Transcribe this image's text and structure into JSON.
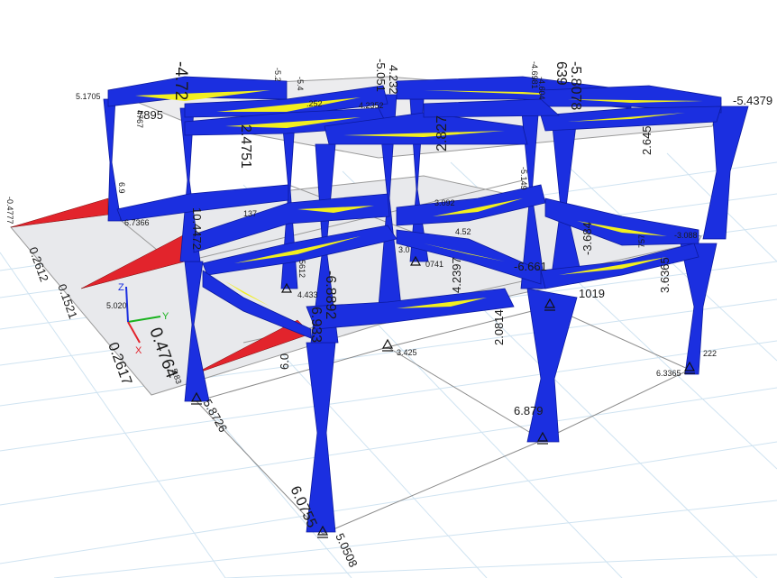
{
  "colors": {
    "background": "#ffffff",
    "grid": "#cfe3f1",
    "slab": "#e8e9ec",
    "frame_blue": "#1b2fe0",
    "frame_blue_dark": "#0c1a9e",
    "positive_yellow": "#f2ef1f",
    "negative_red": "#e2242c",
    "support": "#111111",
    "axis_x": "#e2242c",
    "axis_y": "#19b21e",
    "axis_z": "#1b2fe0"
  },
  "axes": {
    "x": "X",
    "y": "Y",
    "z": "Z"
  },
  "labels": {
    "c_top_left_big": "-4.72",
    "c_top_2": "-5.2",
    "c_top_3": "-5.4",
    "c_top_4": "-5.051",
    "c_top_5": "4.232",
    "c_top_6": "4.2352",
    "c_top_7": "-4.6981",
    "c_top_8": "-4.604",
    "c_top_9": "639",
    "c_top_10": "-5.8078",
    "c_right_top": "-5.4379",
    "c_roof_a": "5.1705",
    "c_roof_b": "7895",
    "c_roof_c": "4767",
    "c_roof_d": "2.4751",
    "c_roof_e": "2.827",
    "c_roof_f": "2.645",
    "c_roof_g": ".252",
    "c_mid_a": "-0.4777",
    "c_mid_b": "6.9",
    "c_mid_c": "6.7366",
    "c_mid_d": "10.4472",
    "c_mid_e": "137",
    "c_mid_f": "3.092",
    "c_mid_g": "4.52",
    "c_mid_h": "-5.149",
    "c_mid_i": "757",
    "c_mid_j": "-3.088",
    "c_mid_k": "-6.661",
    "c_mid_l": "-3.684",
    "c_left_a": "0.2612",
    "c_left_b": "0.1521",
    "c_left_c": "0.2617",
    "c_left_big": "0.4764",
    "c_left_d": "5.020",
    "c_left_e": "5.83",
    "c_low_a": "5.8726",
    "c_low_b": "6.0",
    "c_low_c": "-6.8892",
    "c_low_d": "6.933",
    "c_low_e": "5612",
    "c_low_f": "4.433",
    "c_low_g": "3.425",
    "c_low_h": "2.0814",
    "c_low_i": "4.2397",
    "c_low_j": "0741",
    "c_low_k": "3.0",
    "c_low_l": "1019",
    "c_low_m": "3.6365",
    "c_low_n": "6.3365",
    "c_low_o": "222",
    "c_low_p": "6.879",
    "c_bot_a": "6.0755",
    "c_bot_b": "5.0508"
  }
}
